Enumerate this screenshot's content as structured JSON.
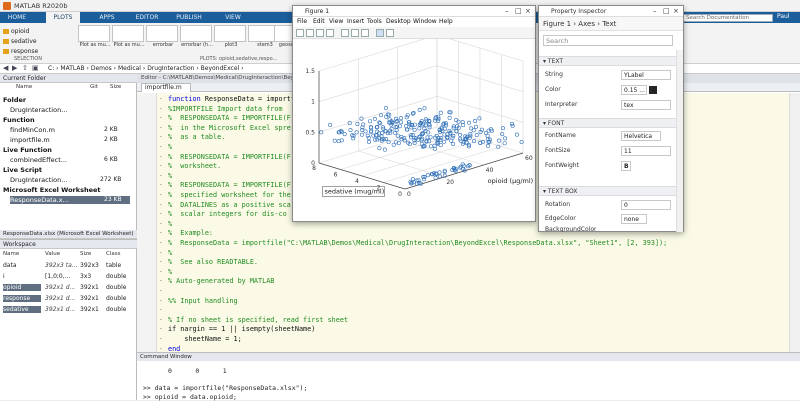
{
  "window": {
    "title": "MATLAB R2020b"
  },
  "tabs": [
    {
      "label": "HOME"
    },
    {
      "label": "PLOTS"
    },
    {
      "label": "APPS"
    },
    {
      "label": "EDITOR"
    },
    {
      "label": "PUBLISH"
    },
    {
      "label": "VIEW"
    }
  ],
  "search": {
    "placeholder": "Search Documentation"
  },
  "user": {
    "label": "Paul"
  },
  "ribbon": {
    "variables": [
      "opioid",
      "sedative",
      "response"
    ],
    "section_label": "SELECTION",
    "plots": [
      {
        "label": "Plot as mu..."
      },
      {
        "label": "Plot as mu..."
      },
      {
        "label": "errorbar"
      },
      {
        "label": "errorbar (h..."
      },
      {
        "label": "plot3"
      },
      {
        "label": "stem3"
      },
      {
        "label": "geoscat..."
      }
    ],
    "footer": "PLOTS: opioid,sedative,respo..."
  },
  "address": {
    "path": "C: › MATLAB › Demos › Medical › DrugInteraction › BeyondExcel ›"
  },
  "current_folder": {
    "title": "Current Folder",
    "columns": [
      "Name",
      "Git",
      "Size"
    ],
    "groups": [
      {
        "label": "Folder",
        "items": [
          {
            "name": "DrugInteraction...",
            "size": ""
          }
        ]
      },
      {
        "label": "Function",
        "items": [
          {
            "name": "findMinCon.m",
            "size": "2 KB"
          },
          {
            "name": "importfile.m",
            "size": "2 KB"
          }
        ]
      },
      {
        "label": "Live Function",
        "items": [
          {
            "name": "combinedEffect...",
            "size": "6 KB"
          }
        ]
      },
      {
        "label": "Live Script",
        "items": [
          {
            "name": "DrugInteraction...",
            "size": "272 KB"
          }
        ]
      },
      {
        "label": "Microsoft Excel Worksheet",
        "items": [
          {
            "name": "ResponseData.x...",
            "size": "23 KB"
          }
        ]
      }
    ]
  },
  "details_bar": "ResponseData.xlsx  (Microsoft Excel Worksheet)",
  "workspace": {
    "title": "Workspace",
    "columns": [
      "Name",
      "Value",
      "Size",
      "Class"
    ],
    "rows": [
      {
        "name": "data",
        "value": "392x3 ta...",
        "size": "392x3",
        "class": "table"
      },
      {
        "name": "i",
        "value": "[1,0;0,...",
        "size": "3x3",
        "class": "double"
      },
      {
        "name": "opioid",
        "value": "392x1 d...",
        "size": "392x1",
        "class": "double"
      },
      {
        "name": "response",
        "value": "392x1 d...",
        "size": "392x1",
        "class": "double"
      },
      {
        "name": "sedative",
        "value": "392x1 d...",
        "size": "392x1",
        "class": "double"
      }
    ]
  },
  "editor": {
    "title": "Editor - C:\\MATLAB\\Demos\\Medical\\DrugInteraction\\BeyondExcel\\importfile.m",
    "tab": "importfile.m",
    "lines": [
      {
        "t": "function ResponseData = importf",
        "c": "c-def",
        "kw": "function"
      },
      {
        "t": "%IMPORTFILE Import data from",
        "c": "c-cmt"
      },
      {
        "t": "%  RESPONSEDATA = IMPORTFILE(F",
        "c": "c-cmt"
      },
      {
        "t": "%  in the Microsoft Excel spre",
        "c": "c-cmt"
      },
      {
        "t": "%  as a table.",
        "c": "c-cmt"
      },
      {
        "t": "%",
        "c": "c-cmt"
      },
      {
        "t": "%  RESPONSEDATA = IMPORTFILE(F",
        "c": "c-cmt"
      },
      {
        "t": "%  worksheet.",
        "c": "c-cmt"
      },
      {
        "t": "%",
        "c": "c-cmt"
      },
      {
        "t": "%  RESPONSEDATA = IMPORTFILE(F",
        "c": "c-cmt"
      },
      {
        "t": "%  specified worksheet for the",
        "c": "c-cmt"
      },
      {
        "t": "%  DATALINES as a positive sca",
        "c": "c-cmt"
      },
      {
        "t": "%  scalar integers for dis-co",
        "c": "c-cmt"
      },
      {
        "t": "%",
        "c": "c-cmt"
      },
      {
        "t": "%  Example:",
        "c": "c-cmt"
      },
      {
        "t": "%  ResponseData = importfile(\"C:\\MATLAB\\Demos\\Medical\\DrugInteraction\\BeyondExcel\\ResponseData.xlsx\", \"Sheet1\", [2, 393]);",
        "c": "c-cmt"
      },
      {
        "t": "%",
        "c": "c-cmt"
      },
      {
        "t": "%  See also READTABLE.",
        "c": "c-cmt"
      },
      {
        "t": "%",
        "c": "c-cmt"
      },
      {
        "t": "% Auto-generated by MATLAB",
        "c": "c-cmt"
      },
      {
        "t": "",
        "c": "c-def"
      },
      {
        "t": "%% Input handling",
        "c": "c-cmt"
      },
      {
        "t": "",
        "c": "c-def"
      },
      {
        "t": "% If no sheet is specified, read first sheet",
        "c": "c-cmt"
      },
      {
        "t": "if nargin == 1 || isempty(sheetName)",
        "c": "c-def"
      },
      {
        "t": "    sheetName = 1;",
        "c": "c-def"
      },
      {
        "t": "end",
        "c": "c-kw"
      }
    ]
  },
  "command_window": {
    "title": "Command Window",
    "matrix_row": "0      0      1",
    "lines": [
      ">> data = importfile(\"ResponseData.xlsx\");",
      ">> opioid = data.opioid;"
    ]
  },
  "figure": {
    "title": "Figure 1",
    "menus": [
      "File",
      "Edit",
      "View",
      "Insert",
      "Tools",
      "Desktop",
      "Window",
      "Help"
    ],
    "xlabel": "opioid (μg/ml)",
    "ylabel": "sedative (mug/ml)",
    "z_ticks": [
      "0",
      "0.5",
      "1",
      "1.5"
    ],
    "x_ticks": [
      "0",
      "20",
      "40",
      "60"
    ],
    "y_ticks": [
      "0",
      "2",
      "4",
      "6",
      "8"
    ],
    "point_color": "#2e6fb8"
  },
  "chart_data": {
    "type": "scatter",
    "dimensions": 3,
    "xlabel": "opioid (μg/ml)",
    "ylabel": "sedative (mug/ml)",
    "zlabel": "",
    "xlim": [
      0,
      60
    ],
    "ylim": [
      0,
      8
    ],
    "zlim": [
      0,
      1.5
    ],
    "grid": true,
    "marker": "open circle"
  },
  "inspector": {
    "title": "Property Inspector",
    "breadcrumb": "Figure 1  ›  Axes  ›  Text",
    "search_placeholder": "Search",
    "sections": [
      {
        "name": "TEXT",
        "props": [
          {
            "label": "String",
            "value": "YLabel"
          },
          {
            "label": "Color",
            "value": "0.15 ..."
          },
          {
            "label": "Interpreter",
            "value": "tex"
          }
        ]
      },
      {
        "name": "FONT",
        "props": [
          {
            "label": "FontName",
            "value": "Helvetica"
          },
          {
            "label": "FontSize",
            "value": "11"
          },
          {
            "label": "FontWeight",
            "value": "B"
          }
        ]
      },
      {
        "name": "TEXT BOX",
        "props": [
          {
            "label": "Rotation",
            "value": "0"
          },
          {
            "label": "EdgeColor",
            "value": "none"
          },
          {
            "label": "BackgroundColor",
            "value": "none"
          }
        ]
      }
    ]
  }
}
